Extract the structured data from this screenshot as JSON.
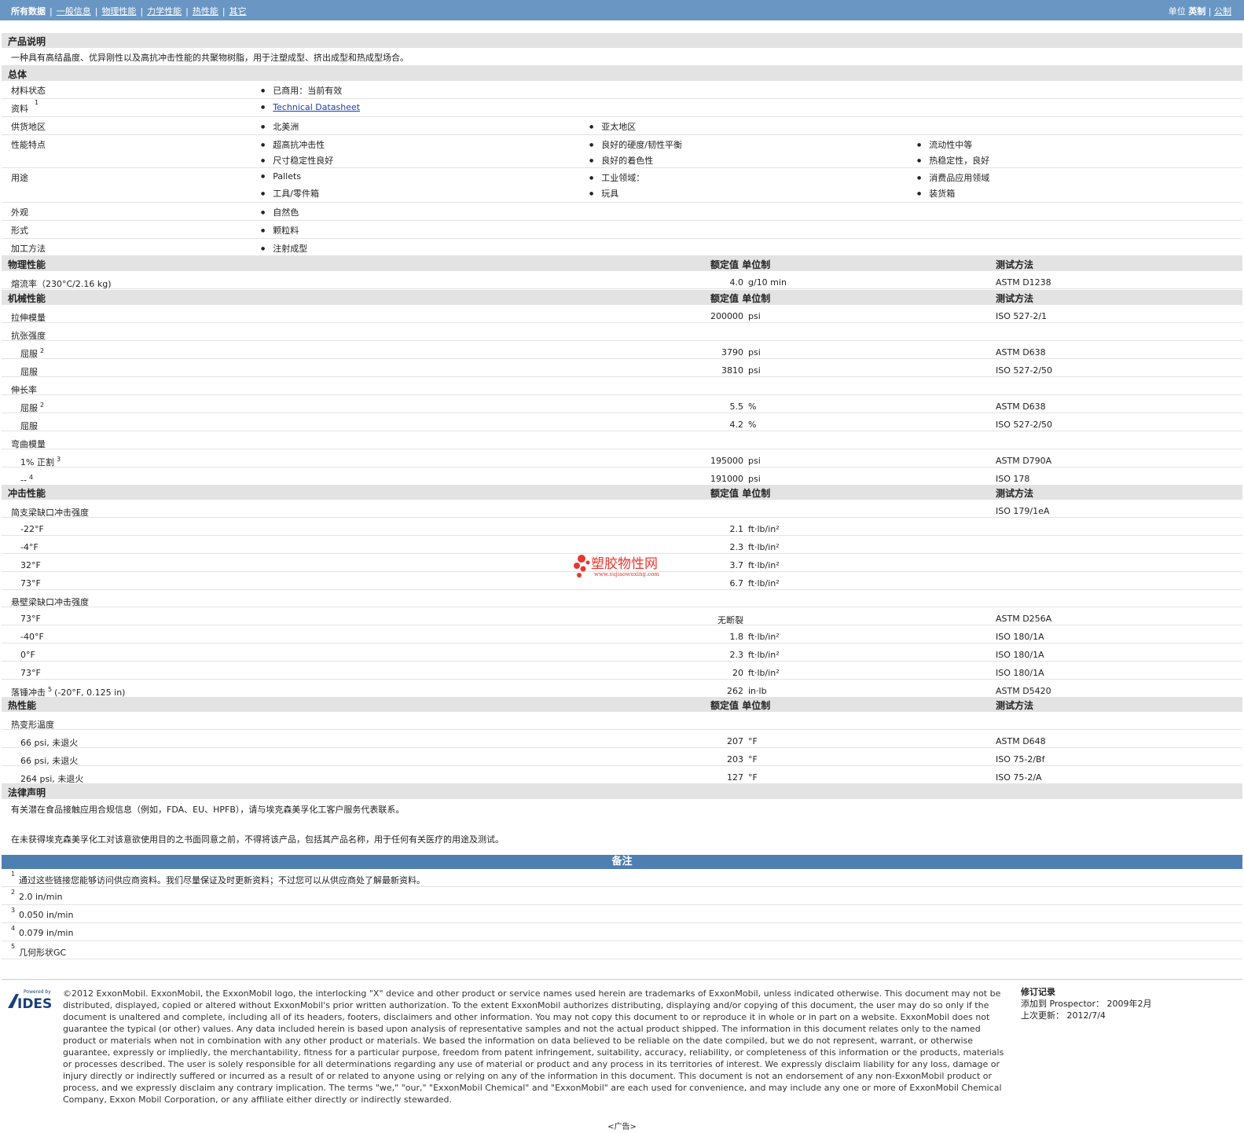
{
  "nav": {
    "active": "所有数据",
    "tabs": [
      "一般信息",
      "物理性能",
      "力学性能",
      "热性能",
      "其它"
    ],
    "unit_label": "单位",
    "unit_active": "英制",
    "unit_other": "公制"
  },
  "product": {
    "title": "产品说明",
    "desc": "一种具有高结晶度、优异刚性以及高抗冲击性能的共聚物树脂，用于注塑成型、挤出成型和热成型场合。"
  },
  "general": {
    "title": "总体",
    "rows": [
      {
        "label": "材料状态",
        "items": [
          "已商用：当前有效"
        ]
      },
      {
        "label": "资料",
        "sup": "1",
        "items": [
          "Technical Datasheet"
        ]
      },
      {
        "label": "供货地区",
        "items": [
          "北美洲",
          "亚太地区"
        ]
      },
      {
        "label": "性能特点",
        "items": [
          "超高抗冲击性",
          "良好的硬度/韧性平衡",
          "流动性中等",
          "尺寸稳定性良好",
          "良好的着色性",
          "热稳定性，良好"
        ]
      },
      {
        "label": "用途",
        "items": [
          "Pallets",
          "工业领域：",
          "消费品应用领域",
          "工具/零件箱",
          "玩具",
          "装货箱"
        ]
      },
      {
        "label": "外观",
        "items": [
          "自然色"
        ]
      },
      {
        "label": "形式",
        "items": [
          "颗粒料"
        ]
      },
      {
        "label": "加工方法",
        "items": [
          "注射成型"
        ]
      }
    ]
  },
  "headers": {
    "value": "额定值",
    "unit": "单位制",
    "method": "测试方法"
  },
  "physical": {
    "title": "物理性能",
    "rows": [
      {
        "label": "熔流率（230°C/2.16 kg)",
        "value": "4.0",
        "unit": "g/10 min",
        "method": "ASTM D1238"
      }
    ]
  },
  "mechanical": {
    "title": "机械性能",
    "rows": [
      {
        "label": "拉伸模量",
        "value": "200000",
        "unit": "psi",
        "method": "ISO 527-2/1"
      },
      {
        "label": "抗张强度"
      },
      {
        "label": "屈服",
        "sup": "2",
        "value": "3790",
        "unit": "psi",
        "method": "ASTM D638"
      },
      {
        "label": "屈服",
        "value": "3810",
        "unit": "psi",
        "method": "ISO 527-2/50"
      },
      {
        "label": "伸长率"
      },
      {
        "label": "屈服",
        "sup": "2",
        "value": "5.5",
        "unit": "%",
        "method": "ASTM D638"
      },
      {
        "label": "屈服",
        "value": "4.2",
        "unit": "%",
        "method": "ISO 527-2/50"
      },
      {
        "label": "弯曲模量"
      },
      {
        "label": "1% 正割",
        "sup": "3",
        "value": "195000",
        "unit": "psi",
        "method": "ASTM D790A"
      },
      {
        "label": "--",
        "sup": "4",
        "value": "191000",
        "unit": "psi",
        "method": "ISO 178"
      }
    ]
  },
  "impact": {
    "title": "冲击性能",
    "rows": [
      {
        "label": "简支梁缺口冲击强度",
        "method": "ISO 179/1eA"
      },
      {
        "label": "-22°F",
        "value": "2.1",
        "unit": "ft·lb/in²"
      },
      {
        "label": "-4°F",
        "value": "2.3",
        "unit": "ft·lb/in²"
      },
      {
        "label": "32°F",
        "value": "3.7",
        "unit": "ft·lb/in²"
      },
      {
        "label": "73°F",
        "value": "6.7",
        "unit": "ft·lb/in²"
      },
      {
        "label": "悬壁梁缺口冲击强度"
      },
      {
        "label": "73°F",
        "value": "无断裂",
        "method": "ASTM D256A"
      },
      {
        "label": "-40°F",
        "value": "1.8",
        "unit": "ft·lb/in²",
        "method": "ISO 180/1A"
      },
      {
        "label": "0°F",
        "value": "2.3",
        "unit": "ft·lb/in²",
        "method": "ISO 180/1A"
      },
      {
        "label": "73°F",
        "value": "20",
        "unit": "ft·lb/in²",
        "method": "ISO 180/1A"
      },
      {
        "label": "落锤冲击",
        "sup": "5",
        "suffix": "(-20°F, 0.125 in)",
        "value": "262",
        "unit": "in·lb",
        "method": "ASTM D5420"
      }
    ]
  },
  "thermal": {
    "title": "热性能",
    "rows": [
      {
        "label": "热变形温度"
      },
      {
        "label": "66 psi, 未退火",
        "value": "207",
        "unit": "°F",
        "method": "ASTM D648"
      },
      {
        "label": "66 psi, 未退火",
        "value": "203",
        "unit": "°F",
        "method": "ISO 75-2/Bf"
      },
      {
        "label": "264 psi, 未退火",
        "value": "127",
        "unit": "°F",
        "method": "ISO 75-2/A"
      }
    ]
  },
  "legal": {
    "title": "法律声明",
    "p1": "有关潜在食品接触应用合规信息（例如，FDA、EU、HPFB），请与埃克森美孚化工客户服务代表联系。",
    "p2": "在未获得埃克森美孚化工对该意欲使用目的之书面同意之前，不得将该产品，包括其产品名称，用于任何有关医疗的用途及测试。"
  },
  "notes": {
    "title": "备注",
    "items": [
      {
        "n": "1",
        "text": "通过这些链接您能够访问供应商资料。我们尽量保证及时更新资料；不过您可以从供应商处了解最新资料。"
      },
      {
        "n": "2",
        "text": "2.0 in/min"
      },
      {
        "n": "3",
        "text": "0.050 in/min"
      },
      {
        "n": "4",
        "text": "0.079 in/min"
      },
      {
        "n": "5",
        "text": "几何形状GC"
      }
    ]
  },
  "footer": {
    "logo_top": "Powered by",
    "logo": "IDES",
    "legal": "©2012 ExxonMobil. ExxonMobil, the ExxonMobil logo, the interlocking \"X\" device and other product or service names used herein are trademarks of ExxonMobil, unless indicated otherwise. This document may not be distributed, displayed, copied or altered without ExxonMobil's prior written authorization. To the extent ExxonMobil authorizes distributing, displaying and/or copying of this document, the user may do so only if the document is unaltered and complete, including all of its headers, footers, disclaimers and other information. You may not copy this document to or reproduce it in whole or in part on a website. ExxonMobil does not guarantee the typical (or other) values. Any data included herein is based upon analysis of representative samples and not the actual product shipped. The information in this document relates only to the named product or materials when not in combination with any other product or materials. We based the information on data believed to be reliable on the date compiled, but we do not represent, warrant, or otherwise guarantee, expressly or impliedly, the merchantability, fitness for a particular purpose, freedom from patent infringement, suitability, accuracy, reliability, or completeness of this information or the products, materials or processes described. The user is solely responsible for all determinations regarding any use of material or product and any process in its territories of interest. We expressly disclaim liability for any loss, damage or injury directly or indirectly suffered or incurred as a result of or related to anyone using or relying on any of the information in this document. This document is not an endorsement of any non-ExxonMobil product or process, and we expressly disclaim any contrary implication. The terms \"we,\" \"our,\" \"ExxonMobil Chemical\" and \"ExxonMobil\" are each used for convenience, and may include any one or more of ExxonMobil Chemical Company, Exxon Mobil Corporation, or any affiliate either directly or indirectly stewarded.",
    "rev_title": "修订记录",
    "rev_added_label": "添加到 Prospector：",
    "rev_added": "2009年2月",
    "rev_updated_label": "上次更新：",
    "rev_updated": "2012/7/4",
    "ad": "<广告>"
  },
  "watermark": {
    "text": "塑胶物性网",
    "url": "www.sujiaowuxing.com"
  },
  "colors": {
    "topbar": "#6a96c4",
    "section": "#e3e3e3",
    "notes_bar": "#4d7fb2",
    "watermark": "#e8372f"
  }
}
